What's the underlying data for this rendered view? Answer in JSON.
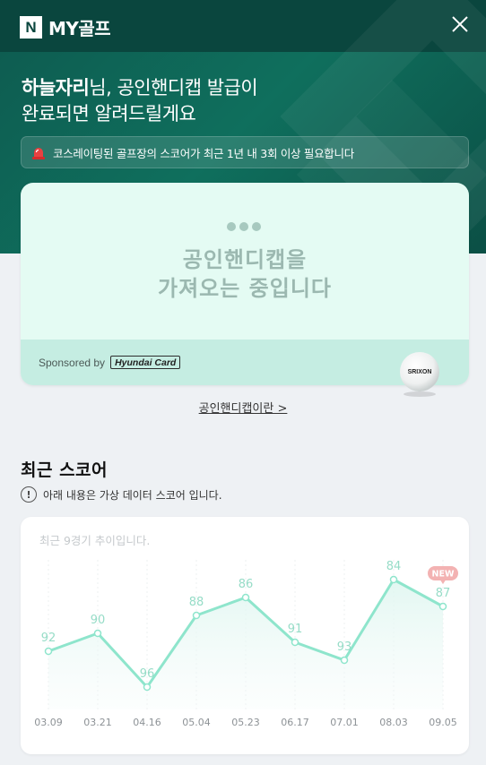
{
  "header": {
    "logo_badge": "N",
    "logo_text": "MY골프"
  },
  "hero": {
    "name": "하늘자리",
    "line1_rest": "님, 공인핸디캡 발급이",
    "line2": "완료되면 알려드릴게요",
    "notice": "코스레이팅된 골프장의 스코어가 최근 1년 내 3회 이상 필요합니다"
  },
  "handicap_card": {
    "line1": "공인핸디캡을",
    "line2": "가져오는 중입니다",
    "sponsored_by": "Sponsored by",
    "sponsor_brand": "Hyundai Card",
    "ball_brand": "SRIXON"
  },
  "about_link": "공인핸디캡이란 >",
  "recent_score": {
    "title": "최근 스코어",
    "notice": "아래 내용은 가상 데이터 스코어 입니다.",
    "caption": "최근 9경기 추이입니다.",
    "new_badge": "NEW"
  },
  "colors": {
    "line": "#8ee5cc",
    "label": "#96dcc7",
    "new_badge": "#f3b2b2"
  },
  "chart_data": {
    "type": "line",
    "categories": [
      "03.09",
      "03.21",
      "04.16",
      "05.04",
      "05.23",
      "06.17",
      "07.01",
      "08.03",
      "09.05"
    ],
    "values": [
      92,
      90,
      96,
      88,
      86,
      91,
      93,
      84,
      87
    ],
    "ylim": [
      98,
      82
    ],
    "grid": false
  }
}
